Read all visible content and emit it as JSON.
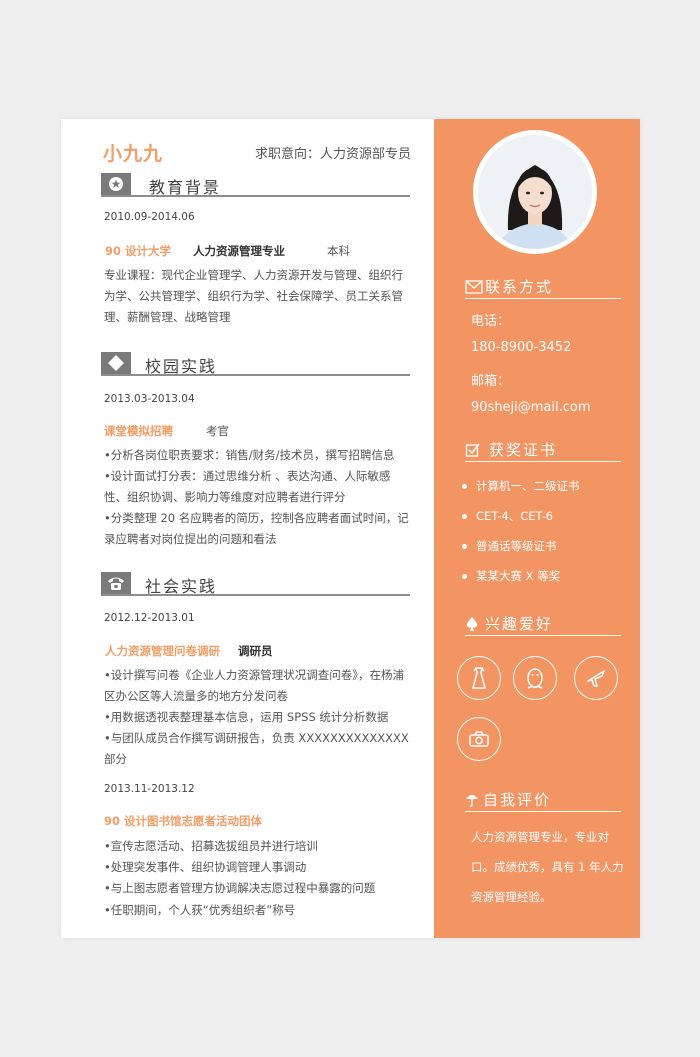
{
  "header": {
    "name": "小九九",
    "intent": "求职意向：人力资源部专员"
  },
  "education": {
    "title": "教育背景",
    "icon": "star-icon",
    "date": "2010.09-2014.06",
    "school": "90 设计大学",
    "major": "人力资源管理专业",
    "degree": "本科",
    "courses": "专业课程：现代企业管理学、人力资源开发与管理、组织行为学、公共管理学、组织行为学、社会保障学、员工关系管理、薪酬管理、战略管理"
  },
  "campus": {
    "title": "校园实践",
    "icon": "diamond-icon",
    "date": "2013.03-2013.04",
    "org": "课堂模拟招聘",
    "role": "考官",
    "bullets": [
      "•分析各岗位职责要求：销售/财务/技术员，撰写招聘信息",
      "•设计面试打分表：通过思维分析 、表达沟通、人际敏感性、组织协调、影响力等维度对应聘者进行评分",
      "•分类整理 20 名应聘者的简历，控制各应聘者面试时间，记录应聘者对岗位提出的问题和看法"
    ]
  },
  "social": {
    "title": "社会实践",
    "icon": "phone-icon",
    "date1": "2012.12-2013.01",
    "org1": "人力资源管理问卷调研",
    "role1": "调研员",
    "bullets1": [
      "•设计撰写问卷《企业人力资源管理状况调查问卷》，在杨浦区办公区等人流量多的地方分发问卷",
      "•用数据透视表整理基本信息，运用 SPSS 统计分析数据",
      "•与团队成员合作撰写调研报告，负责 XXXXXXXXXXXXXX 部分"
    ],
    "date2": "2013.11-2013.12",
    "org2": "90 设计图书馆志愿者活动团体",
    "bullets2": [
      "•宣传志愿活动、招募选拔组员并进行培训",
      "•处理突发事件、组织协调管理人事调动",
      "•与上图志愿者管理方协调解决志愿过程中暴露的问题",
      "•任职期间，个人获“优秀组织者”称号"
    ]
  },
  "contact": {
    "title": "联系方式",
    "icon": "envelope-icon",
    "phone_label": "电话：",
    "phone": "180-8900-3452",
    "email_label": "邮箱：",
    "email": "90sheji@mail.com"
  },
  "awards": {
    "title": "获奖证书",
    "icon": "checkbox-icon",
    "items": [
      "计算机一、二级证书",
      "CET-4、CET-6",
      "普通话等级证书",
      "某某大赛 X 等奖"
    ]
  },
  "hobbies": {
    "title": "兴趣爱好",
    "icon": "spade-icon",
    "items": [
      "dress-icon",
      "penguin-icon",
      "plane-icon",
      "camera-icon"
    ]
  },
  "self_eval": {
    "title": "自我评价",
    "icon": "umbrella-icon",
    "text": "人力资源管理专业，专业对口。成绩优秀，具有 1 年人力资源管理经验。"
  },
  "colors": {
    "accent": "#f39463",
    "accent_text": "#f39d66",
    "gray": "#7a7a7a"
  }
}
